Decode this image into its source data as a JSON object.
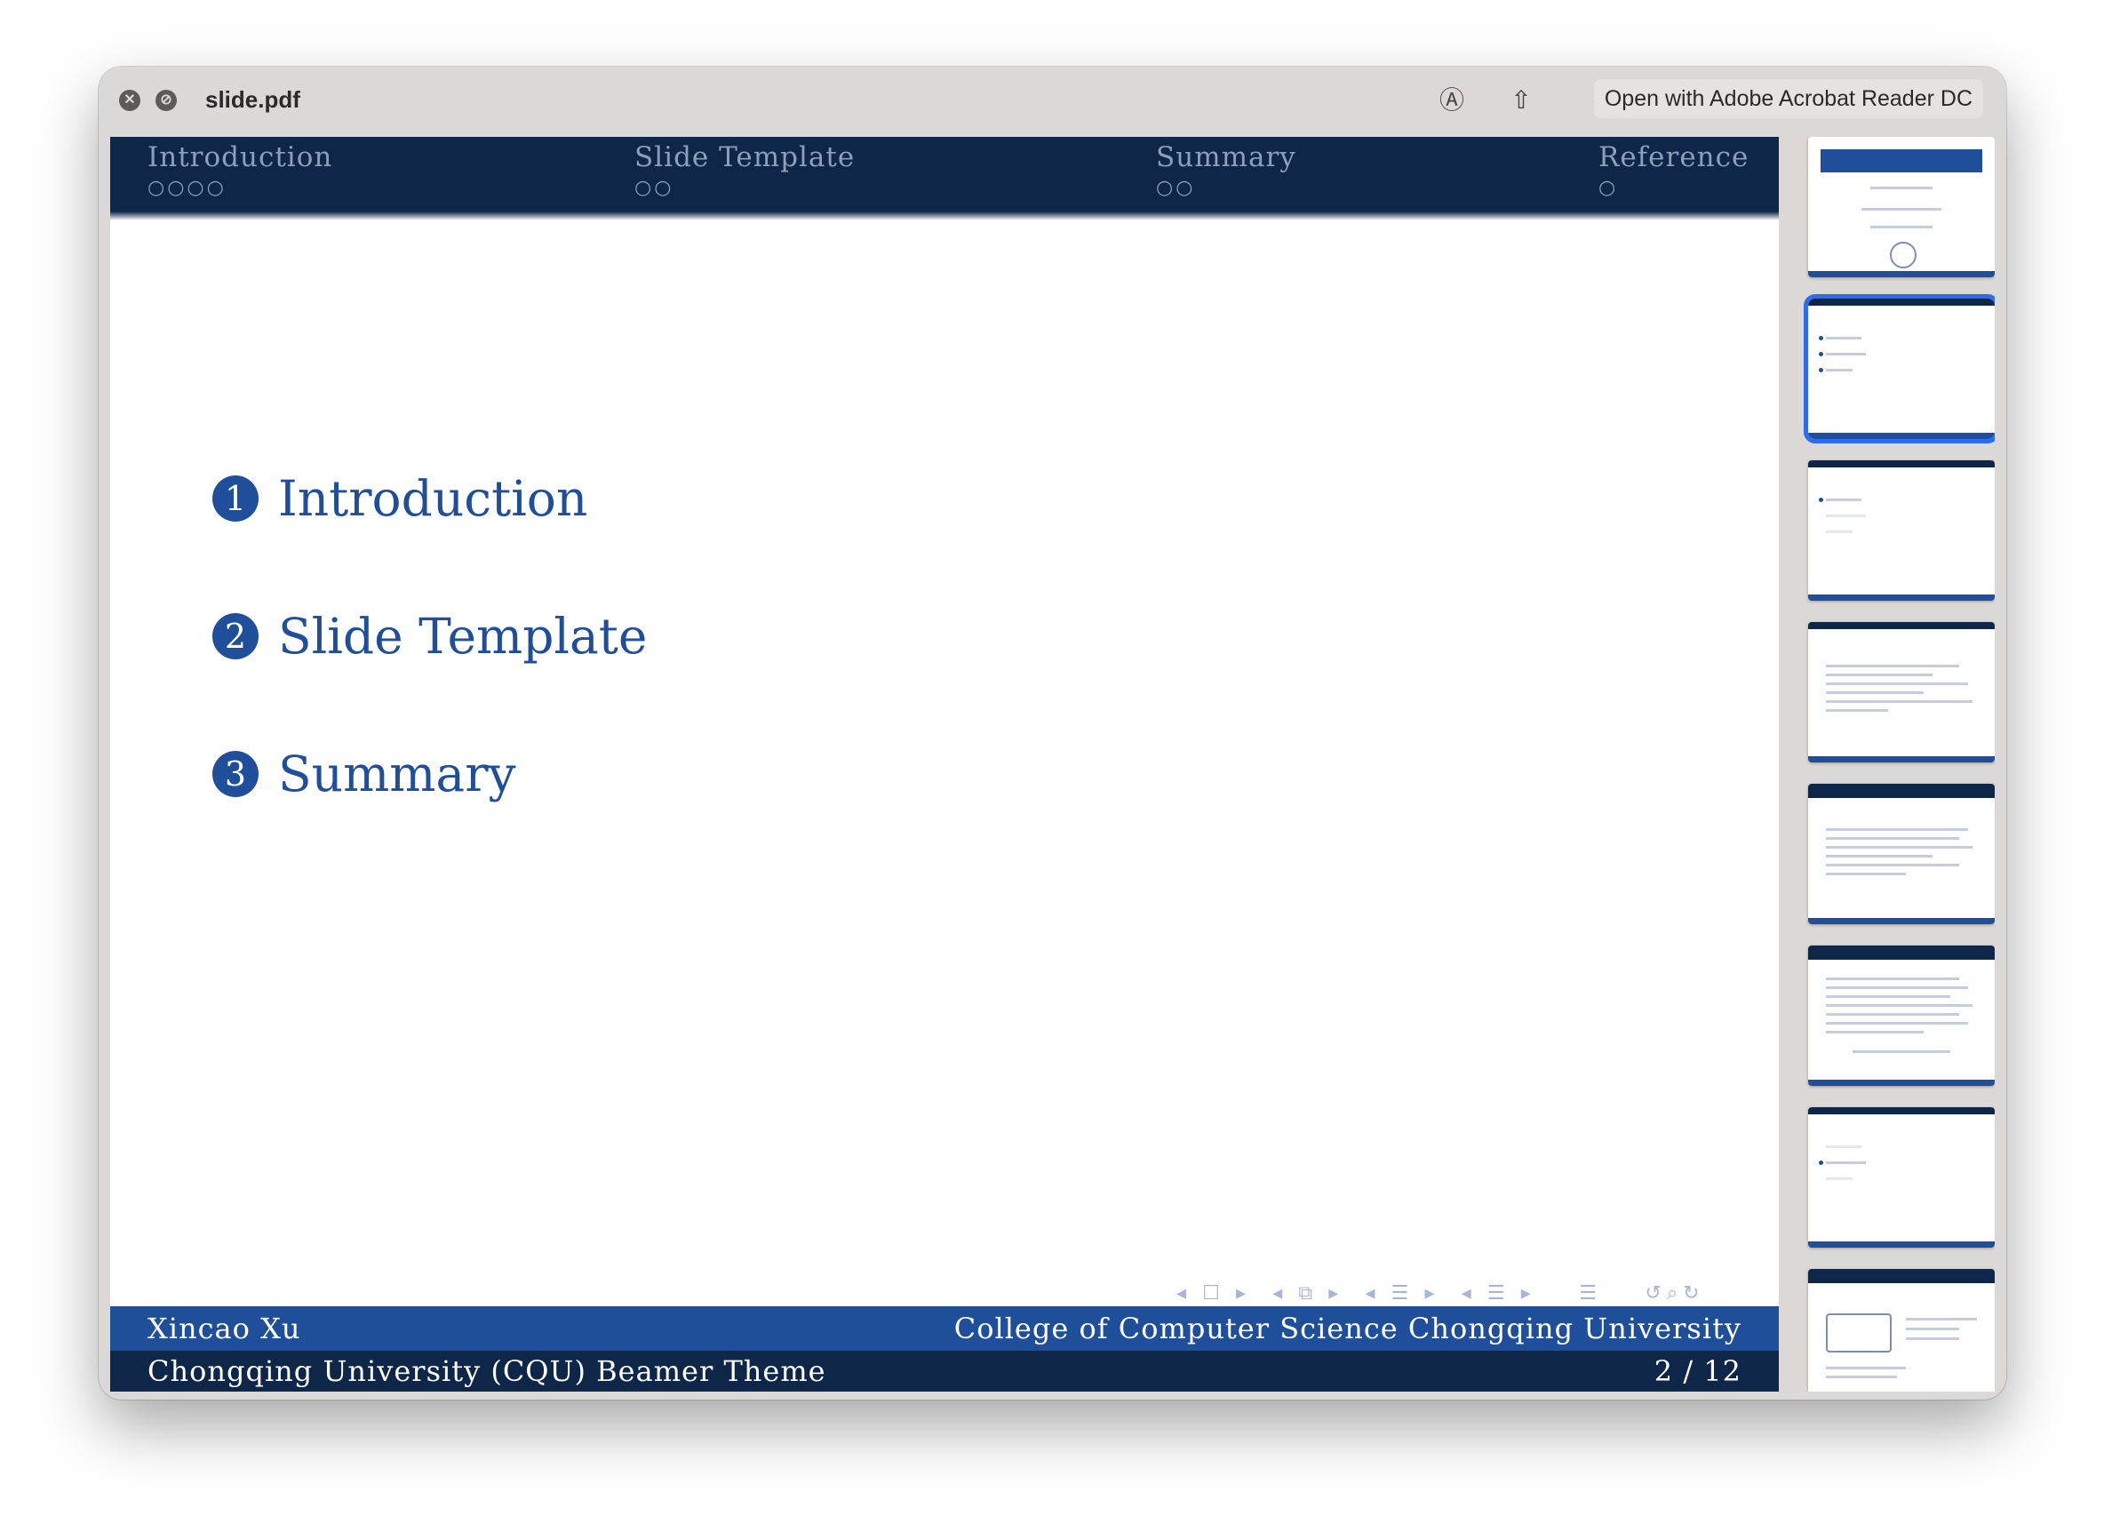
{
  "window": {
    "file_name": "slide.pdf",
    "open_with_label": "Open with Adobe Acrobat Reader DC",
    "icons": [
      "close-icon",
      "block-icon",
      "markup-icon",
      "share-icon"
    ]
  },
  "slide": {
    "nav": [
      {
        "title": "Introduction",
        "dots": "○○○○"
      },
      {
        "title": "Slide Template",
        "dots": "○○"
      },
      {
        "title": "Summary",
        "dots": "○○"
      },
      {
        "title": "Reference",
        "dots": "○"
      }
    ],
    "toc": [
      {
        "num": "1",
        "label": "Introduction"
      },
      {
        "num": "2",
        "label": "Slide Template"
      },
      {
        "num": "3",
        "label": "Summary"
      }
    ],
    "footer": {
      "author": "Xincao Xu",
      "institute": "College of Computer Science Chongqing University",
      "title": "Chongqing University (CQU) Beamer Theme",
      "page": "2 / 12"
    },
    "colors": {
      "primary": "#1f4e9a",
      "dark": "#0e2749",
      "nav_text": "#8d9fb9"
    }
  },
  "thumbnails": {
    "count": 8,
    "selected_index": 1
  }
}
